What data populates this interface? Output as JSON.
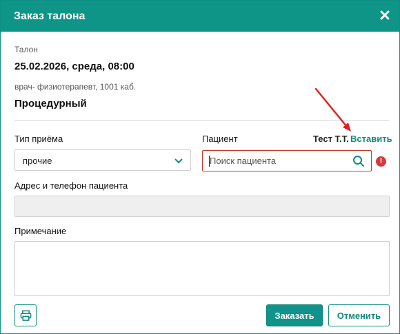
{
  "dialog": {
    "title": "Заказ талона",
    "close_icon": "close-icon"
  },
  "ticket": {
    "section_label": "Талон",
    "datetime": "25.02.2026, среда, 08:00",
    "doctor": "врач- физиотерапевт, 1001 каб.",
    "room_name": "Процедурный"
  },
  "form": {
    "visit_type_label": "Тип приёма",
    "visit_type_value": "прочие",
    "patient_label": "Пациент",
    "patient_placeholder": "Поиск пациента",
    "insert_name": "Тест Т.Т.",
    "insert_link": "Вставить",
    "error_mark": "!",
    "address_label": "Адрес и телефон пациента",
    "address_value": "",
    "note_label": "Примечание",
    "note_value": ""
  },
  "footer": {
    "order_label": "Заказать",
    "cancel_label": "Отменить",
    "print_icon": "print-icon"
  },
  "colors": {
    "accent": "#0f9488",
    "error": "#d63a3a",
    "annotation_arrow": "#e02020"
  }
}
